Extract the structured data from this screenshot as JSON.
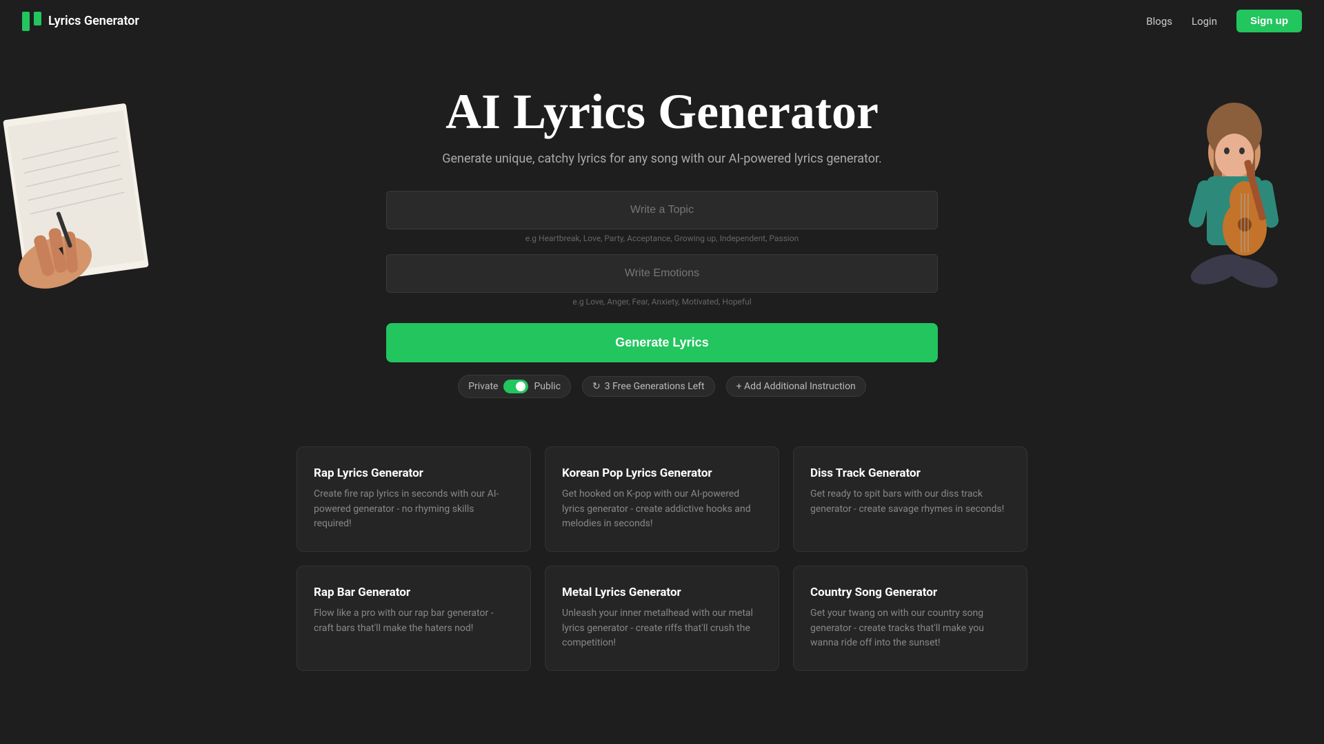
{
  "navbar": {
    "logo_text": "Lyrics Generator",
    "blogs_label": "Blogs",
    "login_label": "Login",
    "signup_label": "Sign up"
  },
  "hero": {
    "title": "AI Lyrics Generator",
    "subtitle": "Generate unique, catchy lyrics for any song with our AI-powered lyrics generator."
  },
  "form": {
    "topic_placeholder": "Write a Topic",
    "topic_hint": "e.g Heartbreak, Love, Party, Acceptance, Growing up, Independent, Passion",
    "emotions_placeholder": "Write Emotions",
    "emotions_hint": "e.g Love, Anger, Fear, Anxiety, Motivated, Hopeful",
    "generate_label": "Generate Lyrics"
  },
  "controls": {
    "private_label": "Private",
    "public_label": "Public",
    "free_gen_label": "3 Free Generations Left",
    "add_instruction_label": "+ Add Additional Instruction"
  },
  "cards": [
    {
      "title": "Rap Lyrics Generator",
      "desc": "Create fire rap lyrics in seconds with our AI-powered generator - no rhyming skills required!"
    },
    {
      "title": "Korean Pop Lyrics Generator",
      "desc": "Get hooked on K-pop with our AI-powered lyrics generator - create addictive hooks and melodies in seconds!"
    },
    {
      "title": "Diss Track Generator",
      "desc": "Get ready to spit bars with our diss track generator - create savage rhymes in seconds!"
    },
    {
      "title": "Rap Bar Generator",
      "desc": "Flow like a pro with our rap bar generator - craft bars that'll make the haters nod!"
    },
    {
      "title": "Metal Lyrics Generator",
      "desc": "Unleash your inner metalhead with our metal lyrics generator - create riffs that'll crush the competition!"
    },
    {
      "title": "Country Song Generator",
      "desc": "Get your twang on with our country song generator - create tracks that'll make you wanna ride off into the sunset!"
    }
  ]
}
